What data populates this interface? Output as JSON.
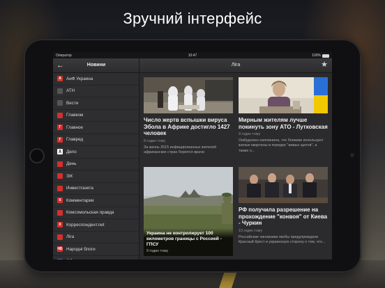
{
  "hero_title": "Зручний інтерфейс",
  "statusbar": {
    "carrier": "Оператор",
    "time": "10:47",
    "battery": "100%"
  },
  "sidebar": {
    "title": "Новини",
    "items": [
      {
        "label": "АиФ Украина",
        "icon": "aif-icon",
        "color": "#c0392b",
        "glyph": "А"
      },
      {
        "label": "АТН",
        "icon": "rss-icon",
        "color": "#555558",
        "glyph": ""
      },
      {
        "label": "Вести",
        "icon": "vesti-icon",
        "color": "#555558",
        "glyph": ""
      },
      {
        "label": "Главком",
        "icon": "glavcom-icon",
        "color": "#d62f2f",
        "glyph": ""
      },
      {
        "label": "Главное",
        "icon": "glavnoe-icon",
        "color": "#d62f2f",
        "glyph": "Г"
      },
      {
        "label": "Главред",
        "icon": "glavred-icon",
        "color": "#d62f2f",
        "glyph": "Г"
      },
      {
        "label": "Дело",
        "icon": "delo-icon",
        "color": "#ffffff",
        "glyph": "Д"
      },
      {
        "label": "День",
        "icon": "den-icon",
        "color": "#d62f2f",
        "glyph": ""
      },
      {
        "label": "ЗІК",
        "icon": "zik-icon",
        "color": "#d62f2f",
        "glyph": ""
      },
      {
        "label": "Инвестгазета",
        "icon": "invest-icon",
        "color": "#d62f2f",
        "glyph": ""
      },
      {
        "label": "Комментарии",
        "icon": "komment-icon",
        "color": "#d62f2f",
        "glyph": "К"
      },
      {
        "label": "Комсомольская правда",
        "icon": "kp-icon",
        "color": "#d62f2f",
        "glyph": ""
      },
      {
        "label": "Корреспондент.net",
        "icon": "korr-icon",
        "color": "#d62f2f",
        "glyph": "К"
      },
      {
        "label": "Ліга",
        "icon": "liga-icon",
        "color": "#d62f2f",
        "glyph": ""
      },
      {
        "label": "Народні блоги",
        "icon": "nb-icon",
        "color": "#d62f2f",
        "glyph": "НБ"
      },
      {
        "label": "Обозреватель",
        "icon": "obozr-icon",
        "color": "#2b6fcf",
        "glyph": ""
      }
    ]
  },
  "main": {
    "title": "Ліга",
    "cards": [
      {
        "headline": "Число жертв вспышки вируса Эбола в Африке достигло 1427 человек",
        "meta": "8 годин тому",
        "summary": "За жизнь 2615 инфицированных жителей африканских стран борются врачи"
      },
      {
        "headline": "Мирным жителям лучше покинуть зону АТО - Лутковская",
        "meta": "9 годин тому",
        "summary": "Омбудсмен напомнила, что боевики используют жилые кварталы в порядке \"живых щитов\", а также о..."
      },
      {
        "headline": "Украина не контролирует 100 километров границы с Россией - ГПСУ",
        "meta": "9 годин тому"
      },
      {
        "headline": "РФ получила разрешение на прохождение \"конвоя\" от Киева - Чуркин",
        "meta": "10 годин тому",
        "summary": "Российские чиновники якобы предупреждали Красный Крест и украинскую сторону о том, что..."
      }
    ]
  }
}
